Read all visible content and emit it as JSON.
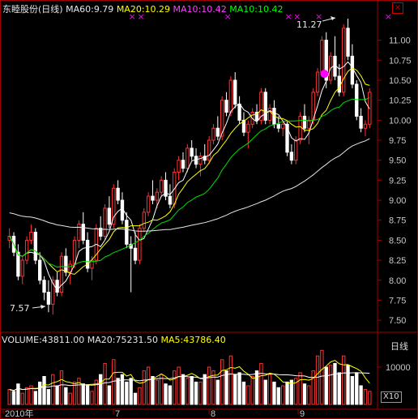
{
  "header": {
    "stock_name": "东睦股份(日线)",
    "ma60_label": "MA60:9.79",
    "ma20_label": "MA20:10.29",
    "ma10_label": "MA10:10.42",
    "ma10b_label": "MA10:10.42"
  },
  "volume_header": {
    "volume_label": "VOLUME:43811.00",
    "ma20_label": "MA20:75231.50",
    "ma5_label": "MA5:43786.40"
  },
  "controls": {
    "close_label": "×",
    "tab_label": "日线",
    "unit_label": "X10"
  },
  "annotations": {
    "high_label": "11.27",
    "low_label": "7.57"
  },
  "colors": {
    "up": "#ff3232",
    "down": "#ffffff",
    "ma5": "#ffffff",
    "ma10": "#ffff00",
    "ma20": "#00e000",
    "ma60": "#e6e6e6",
    "marker": "#ff00ff",
    "axis": "#a00000",
    "ma20_text": "#ffff00",
    "ma10_text": "#ff40ff",
    "ma10b_text": "#00ff00"
  },
  "chart_data": {
    "type": "candlestick",
    "price_axis": {
      "ylim": [
        7.4,
        11.3
      ],
      "ticks": [
        "11.00",
        "10.75",
        "10.50",
        "10.25",
        "10.00",
        "9.75",
        "9.50",
        "9.25",
        "9.00",
        "8.75",
        "8.50",
        "8.25",
        "8.00",
        "7.75",
        "7.50"
      ]
    },
    "volume_axis": {
      "ylim": [
        0,
        15000
      ],
      "ticks": [
        "10000"
      ]
    },
    "month_labels": [
      "2010年",
      "7",
      "8",
      "9"
    ],
    "candles": [
      [
        8.5,
        8.65,
        8.4,
        8.55
      ],
      [
        8.55,
        8.6,
        8.3,
        8.35
      ],
      [
        8.35,
        8.45,
        8.0,
        8.05
      ],
      [
        8.05,
        8.3,
        7.95,
        8.25
      ],
      [
        8.25,
        8.55,
        8.2,
        8.5
      ],
      [
        8.5,
        8.7,
        8.45,
        8.6
      ],
      [
        8.6,
        8.65,
        8.2,
        8.25
      ],
      [
        8.25,
        8.35,
        7.95,
        8.0
      ],
      [
        8.0,
        8.05,
        7.75,
        7.85
      ],
      [
        7.85,
        8.0,
        7.6,
        7.7
      ],
      [
        7.7,
        8.05,
        7.57,
        8.0
      ],
      [
        8.0,
        8.1,
        7.8,
        7.85
      ],
      [
        7.85,
        8.35,
        7.8,
        8.3
      ],
      [
        8.3,
        8.4,
        8.05,
        8.1
      ],
      [
        8.1,
        8.25,
        7.95,
        8.2
      ],
      [
        8.2,
        8.55,
        8.15,
        8.5
      ],
      [
        8.5,
        8.75,
        8.4,
        8.7
      ],
      [
        8.7,
        8.85,
        8.45,
        8.5
      ],
      [
        8.5,
        8.6,
        8.1,
        8.15
      ],
      [
        8.15,
        8.3,
        8.0,
        8.25
      ],
      [
        8.25,
        8.7,
        8.2,
        8.65
      ],
      [
        8.65,
        8.8,
        8.5,
        8.55
      ],
      [
        8.55,
        8.95,
        8.5,
        8.9
      ],
      [
        8.9,
        9.05,
        8.65,
        8.7
      ],
      [
        8.7,
        9.2,
        8.65,
        9.15
      ],
      [
        9.15,
        9.25,
        8.95,
        9.0
      ],
      [
        9.0,
        9.1,
        8.7,
        8.75
      ],
      [
        8.75,
        8.85,
        8.4,
        8.45
      ],
      [
        8.45,
        8.55,
        7.85,
        8.4
      ],
      [
        8.4,
        8.6,
        8.2,
        8.25
      ],
      [
        8.25,
        8.7,
        8.2,
        8.65
      ],
      [
        8.65,
        8.9,
        8.6,
        8.85
      ],
      [
        8.85,
        9.1,
        8.8,
        9.05
      ],
      [
        9.05,
        9.25,
        8.95,
        9.0
      ],
      [
        9.0,
        9.15,
        8.9,
        9.1
      ],
      [
        9.1,
        9.3,
        9.05,
        9.25
      ],
      [
        9.25,
        9.35,
        9.0,
        9.05
      ],
      [
        9.05,
        9.2,
        8.9,
        8.95
      ],
      [
        8.95,
        9.4,
        8.9,
        9.35
      ],
      [
        9.35,
        9.55,
        9.25,
        9.5
      ],
      [
        9.5,
        9.6,
        9.35,
        9.4
      ],
      [
        9.4,
        9.7,
        9.35,
        9.65
      ],
      [
        9.65,
        9.75,
        9.5,
        9.55
      ],
      [
        9.55,
        9.65,
        9.4,
        9.45
      ],
      [
        9.45,
        9.6,
        9.3,
        9.55
      ],
      [
        9.55,
        9.7,
        9.45,
        9.5
      ],
      [
        9.5,
        9.8,
        9.45,
        9.75
      ],
      [
        9.75,
        9.95,
        9.7,
        9.9
      ],
      [
        9.9,
        10.05,
        9.75,
        9.8
      ],
      [
        9.8,
        10.3,
        9.75,
        10.25
      ],
      [
        10.25,
        10.35,
        10.05,
        10.1
      ],
      [
        10.1,
        10.55,
        10.05,
        10.5
      ],
      [
        10.5,
        10.6,
        10.15,
        10.2
      ],
      [
        10.2,
        10.3,
        9.95,
        10.0
      ],
      [
        10.0,
        10.1,
        9.8,
        9.85
      ],
      [
        9.85,
        10.0,
        9.65,
        9.95
      ],
      [
        9.95,
        10.15,
        9.9,
        10.1
      ],
      [
        10.1,
        10.2,
        9.95,
        10.0
      ],
      [
        10.0,
        10.4,
        9.95,
        10.35
      ],
      [
        10.35,
        10.4,
        9.95,
        10.0
      ],
      [
        10.0,
        10.2,
        9.95,
        10.15
      ],
      [
        10.15,
        10.25,
        9.9,
        9.95
      ],
      [
        9.95,
        10.05,
        9.85,
        9.9
      ],
      [
        9.9,
        10.0,
        9.8,
        9.95
      ],
      [
        9.95,
        10.0,
        9.55,
        9.6
      ],
      [
        9.6,
        9.7,
        9.45,
        9.5
      ],
      [
        9.5,
        9.8,
        9.45,
        9.75
      ],
      [
        9.75,
        10.1,
        9.7,
        10.05
      ],
      [
        10.05,
        10.2,
        9.85,
        9.9
      ],
      [
        9.9,
        10.05,
        9.7,
        10.0
      ],
      [
        10.0,
        10.4,
        9.95,
        10.35
      ],
      [
        10.35,
        10.65,
        10.3,
        10.6
      ],
      [
        10.6,
        11.05,
        10.55,
        11.0
      ],
      [
        11.0,
        11.1,
        10.4,
        10.5
      ],
      [
        10.5,
        10.85,
        10.45,
        10.8
      ],
      [
        10.8,
        11.05,
        10.5,
        10.55
      ],
      [
        10.55,
        10.7,
        10.3,
        10.35
      ],
      [
        10.35,
        11.2,
        10.3,
        11.15
      ],
      [
        11.15,
        11.27,
        10.75,
        10.8
      ],
      [
        10.8,
        10.95,
        10.4,
        10.45
      ],
      [
        10.45,
        10.5,
        10.0,
        10.05
      ],
      [
        10.05,
        10.15,
        9.85,
        9.9
      ],
      [
        9.9,
        10.0,
        9.8,
        9.95
      ],
      [
        9.95,
        10.4,
        9.9,
        10.35
      ]
    ],
    "volumes": [
      4000,
      3500,
      5500,
      3000,
      4500,
      5000,
      3500,
      6000,
      7500,
      4000,
      8000,
      5000,
      9000,
      4500,
      3000,
      6000,
      7000,
      5500,
      5000,
      3500,
      6500,
      8000,
      11000,
      5000,
      12000,
      7000,
      8000,
      6000,
      7000,
      3000,
      4500,
      9000,
      10000,
      7500,
      6500,
      8000,
      5500,
      5000,
      9000,
      10000,
      8000,
      7000,
      7500,
      6000,
      6000,
      8000,
      10000,
      9000,
      6500,
      12000,
      9000,
      13000,
      8000,
      8500,
      6000,
      5000,
      7500,
      9000,
      11000,
      6500,
      8000,
      6000,
      4500,
      5000,
      6000,
      6500,
      7000,
      8500,
      5500,
      5000,
      9000,
      13000,
      14500,
      10000,
      10500,
      11000,
      8500,
      13000,
      10500,
      7500,
      8500,
      5000,
      4000,
      3500
    ]
  }
}
